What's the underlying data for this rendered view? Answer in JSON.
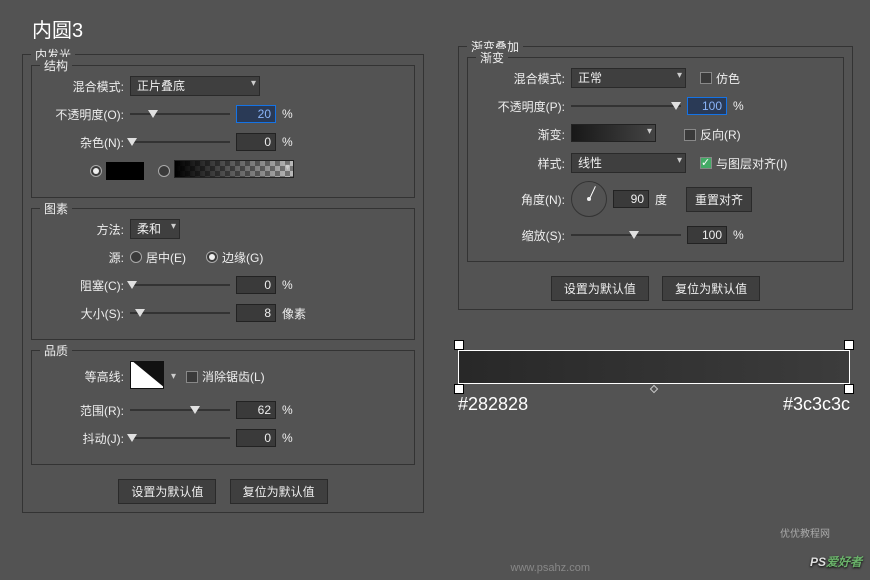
{
  "title": "内圆3",
  "innerGlow": {
    "legend": "内发光",
    "structure": {
      "legend": "结构",
      "blendMode": {
        "label": "混合模式:",
        "value": "正片叠底"
      },
      "opacity": {
        "label": "不透明度(O):",
        "value": "20",
        "unit": "%"
      },
      "noise": {
        "label": "杂色(N):",
        "value": "0",
        "unit": "%"
      }
    },
    "elements": {
      "legend": "图素",
      "technique": {
        "label": "方法:",
        "value": "柔和"
      },
      "source": {
        "label": "源:",
        "opt1": "居中(E)",
        "opt2": "边缘(G)"
      },
      "choke": {
        "label": "阻塞(C):",
        "value": "0",
        "unit": "%"
      },
      "size": {
        "label": "大小(S):",
        "value": "8",
        "unit": "像素"
      }
    },
    "quality": {
      "legend": "品质",
      "contour": {
        "label": "等高线:",
        "antialias": "消除锯齿(L)"
      },
      "range": {
        "label": "范围(R):",
        "value": "62",
        "unit": "%"
      },
      "jitter": {
        "label": "抖动(J):",
        "value": "0",
        "unit": "%"
      }
    },
    "buttons": {
      "default": "设置为默认值",
      "reset": "复位为默认值"
    }
  },
  "gradOverlay": {
    "legend": "渐变叠加",
    "gradient": {
      "legend": "渐变",
      "blendMode": {
        "label": "混合模式:",
        "value": "正常",
        "dither": "仿色"
      },
      "opacity": {
        "label": "不透明度(P):",
        "value": "100",
        "unit": "%"
      },
      "gradient": {
        "label": "渐变:",
        "reverse": "反向(R)"
      },
      "style": {
        "label": "样式:",
        "value": "线性",
        "align": "与图层对齐(I)"
      },
      "angle": {
        "label": "角度(N):",
        "value": "90",
        "unit": "度",
        "reset": "重置对齐"
      },
      "scale": {
        "label": "缩放(S):",
        "value": "100",
        "unit": "%"
      }
    },
    "buttons": {
      "default": "设置为默认值",
      "reset": "复位为默认值"
    }
  },
  "gradBar": {
    "left": "#282828",
    "right": "#3c3c3c"
  },
  "footer": {
    "psahz": "www.psahz.com",
    "wm2": "优优教程网",
    "brand1": "PS",
    "brand2": "爱好者"
  }
}
